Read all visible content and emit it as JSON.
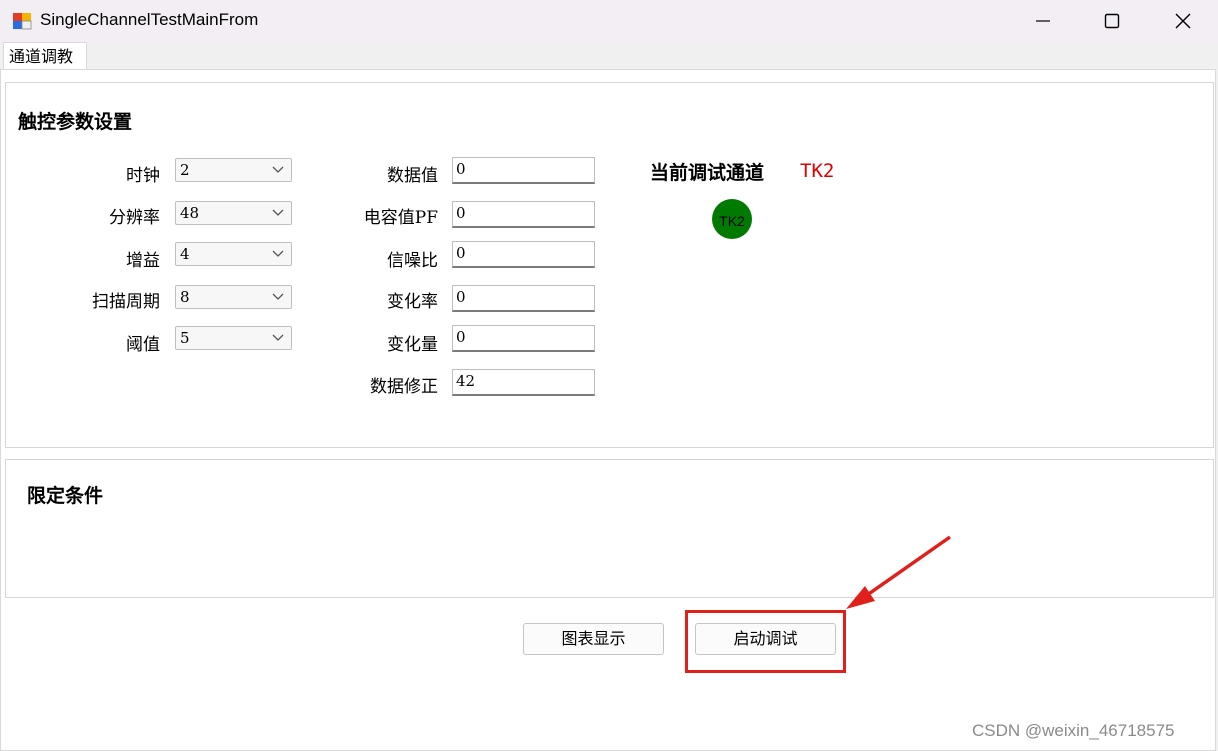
{
  "window": {
    "title": "SingleChannelTestMainFrom",
    "controls": [
      "minimize-icon",
      "maximize-icon",
      "close-icon"
    ]
  },
  "tabs": [
    {
      "label": "通道调教",
      "selected": true
    }
  ],
  "touch_params": {
    "title": "触控参数设置",
    "combos": [
      {
        "label": "时钟",
        "value": "2"
      },
      {
        "label": "分辨率",
        "value": "48"
      },
      {
        "label": "增益",
        "value": "4"
      },
      {
        "label": "扫描周期",
        "value": "8"
      },
      {
        "label": "阈值",
        "value": "5"
      }
    ],
    "fields": [
      {
        "label": "数据值",
        "value": "0"
      },
      {
        "label": "电容值PF",
        "value": "0"
      },
      {
        "label": "信噪比",
        "value": "0"
      },
      {
        "label": "变化率",
        "value": "0"
      },
      {
        "label": "变化量",
        "value": "0"
      },
      {
        "label": "数据修正",
        "value": "42"
      }
    ],
    "current_channel_label": "当前调试通道",
    "current_channel_value": "TK2",
    "indicator_text": "TK2",
    "indicator_color": "#007a00"
  },
  "limits": {
    "title": "限定条件"
  },
  "buttons": {
    "chart": "图表显示",
    "start": "启动调试"
  },
  "annotation": {
    "color": "#e0201b"
  },
  "watermark": "CSDN @weixin_46718575"
}
